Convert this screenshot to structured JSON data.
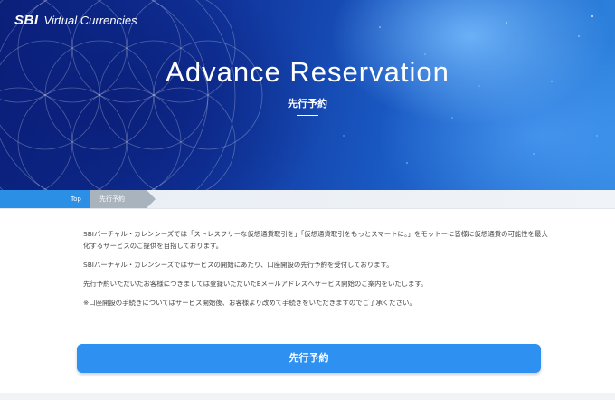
{
  "header": {
    "logo_brand": "SBI",
    "logo_text": "Virtual Currencies",
    "title": "Advance Reservation",
    "subtitle": "先行予約"
  },
  "breadcrumb": {
    "items": [
      "Top",
      "先行予約"
    ]
  },
  "main": {
    "paragraphs": [
      "SBIバーチャル・カレンシーズでは「ストレスフリーな仮想通貨取引を」「仮想通貨取引をもっとスマートに。」をモットーに皆様に仮想通貨の可能性を最大化するサービスのご提供を目指しております。",
      "SBIバーチャル・カレンシーズではサービスの開始にあたり、口座開設の先行予約を受付しております。",
      "先行予約いただいたお客様につきましては登録いただいたEメールアドレスへサービス開始のご案内をいたします。",
      "※口座開設の手続きについてはサービス開始後、お客様より改めて手続きをいただきますのでご了承ください。"
    ],
    "cta_label": "先行予約"
  },
  "colors": {
    "accent": "#2e90f0",
    "breadcrumb_active": "#2b8fe6",
    "breadcrumb_current": "#a9b3bd"
  }
}
